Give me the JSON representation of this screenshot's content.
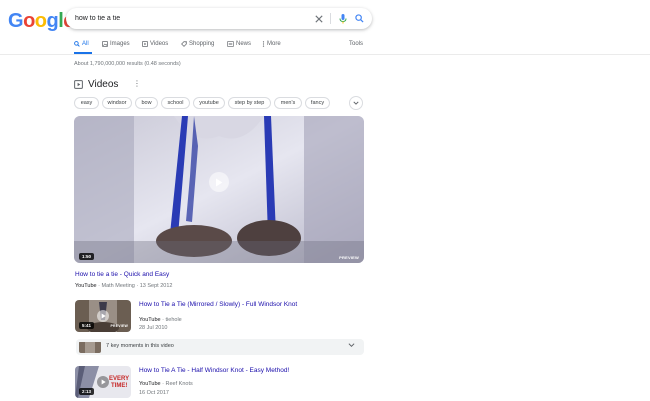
{
  "header": {
    "logo_letters": [
      {
        "ch": "G",
        "color": "#4285F4"
      },
      {
        "ch": "o",
        "color": "#EA4335"
      },
      {
        "ch": "o",
        "color": "#FBBC05"
      },
      {
        "ch": "g",
        "color": "#4285F4"
      },
      {
        "ch": "l",
        "color": "#34A853"
      },
      {
        "ch": "e",
        "color": "#EA4335"
      }
    ],
    "search_query": "how to tie a tie",
    "icons": {
      "clear": "close-icon",
      "mic": "mic-icon",
      "search": "search-icon"
    }
  },
  "tabs": [
    {
      "label": "All",
      "icon": "search-icon",
      "active": true
    },
    {
      "label": "Images",
      "icon": "image-icon"
    },
    {
      "label": "Videos",
      "icon": "video-icon"
    },
    {
      "label": "Shopping",
      "icon": "tag-icon"
    },
    {
      "label": "News",
      "icon": "news-icon"
    },
    {
      "label": "More",
      "icon": "more-icon"
    }
  ],
  "tools_label": "Tools",
  "result_stats": "About 1,790,000,000 results (0.48 seconds)",
  "videos_section": {
    "title": "Videos",
    "chips": [
      "easy",
      "windsor",
      "bow",
      "school",
      "youtube",
      "step by step",
      "men's",
      "fancy"
    ],
    "featured": {
      "duration": "1:50",
      "preview_label": "PREVIEW",
      "title": "How to tie a tie - Quick and Easy",
      "source": "YouTube",
      "channel": "Math Meeting",
      "date": "13 Sept 2012"
    },
    "items": [
      {
        "duration": "5:41",
        "preview_label": "PREVIEW",
        "title": "How to Tie a Tie (Mirrored / Slowly) - Full Windsor Knot",
        "source": "YouTube",
        "channel": "tiehole",
        "date": "28 Jul 2010"
      },
      {
        "duration": "2:13",
        "thumb_text": [
          "EVERY",
          "TIME!"
        ],
        "title": "How to Tie A Tie - Half Windsor Knot - Easy Method!",
        "source": "YouTube",
        "channel": "Reef Knots",
        "date": "16 Oct 2017"
      }
    ],
    "key_moments_label": "7 key moments in this video"
  },
  "colors": {
    "link": "#1a0dab",
    "accent": "#1a73e8",
    "tie_blue": "#2a3bb5"
  }
}
